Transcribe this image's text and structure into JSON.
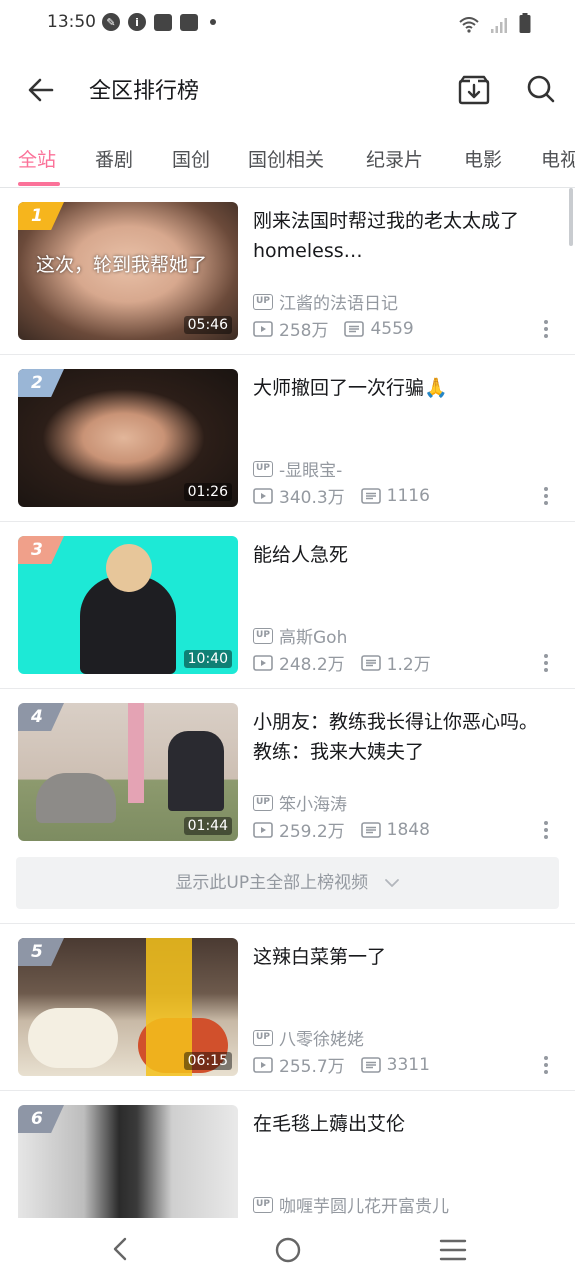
{
  "status_bar": {
    "time": "13:50"
  },
  "header": {
    "title": "全区排行榜"
  },
  "tabs": [
    {
      "label": "全站",
      "active": true
    },
    {
      "label": "番剧"
    },
    {
      "label": "国创"
    },
    {
      "label": "国创相关"
    },
    {
      "label": "纪录片"
    },
    {
      "label": "电影"
    },
    {
      "label": "电视"
    }
  ],
  "accent_color": "#fb7299",
  "videos": [
    {
      "rank": "1",
      "title": "刚来法国时帮过我的老太太成了homeless…",
      "up": "江酱的法语日记",
      "plays": "258万",
      "danmaku": "4559",
      "duration": "05:46",
      "thumb_text": "这次，轮到我帮她了",
      "rank_color": "#f6b51d"
    },
    {
      "rank": "2",
      "title": "大师撤回了一次行骗🙏",
      "up": "-显眼宝-",
      "plays": "340.3万",
      "danmaku": "1116",
      "duration": "01:26",
      "rank_color": "#9ab6d6"
    },
    {
      "rank": "3",
      "title": "能给人急死",
      "up": "高斯Goh",
      "plays": "248.2万",
      "danmaku": "1.2万",
      "duration": "10:40",
      "rank_color": "#f0a08a"
    },
    {
      "rank": "4",
      "title": "小朋友：教练我长得让你恶心吗。 教练：我来大姨夫了",
      "up": "笨小海涛",
      "plays": "259.2万",
      "danmaku": "1848",
      "duration": "01:44",
      "rank_color": "#8e96a6"
    },
    {
      "rank": "5",
      "title": "这辣白菜第一了",
      "up": "八零徐姥姥",
      "plays": "255.7万",
      "danmaku": "3311",
      "duration": "06:15",
      "rank_color": "#8e96a6"
    },
    {
      "rank": "6",
      "title": "在毛毯上薅出艾伦",
      "up": "咖喱芋圆儿花开富贵儿",
      "plays": "",
      "danmaku": "",
      "duration": "",
      "rank_color": "#8e96a6"
    }
  ],
  "show_all": "显示此UP主全部上榜视频"
}
